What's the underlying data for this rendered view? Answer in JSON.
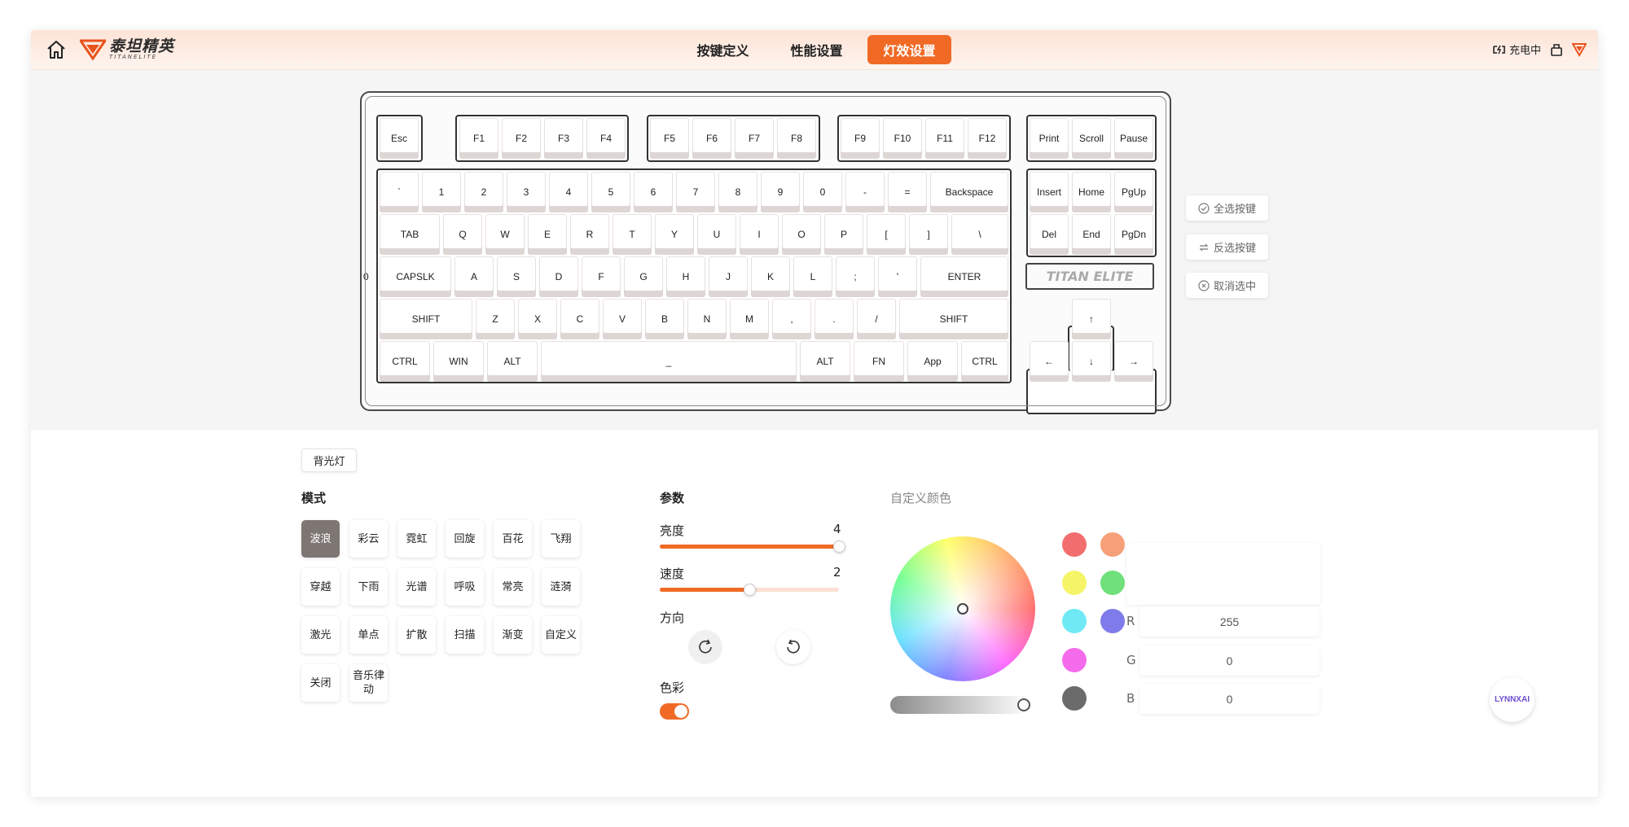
{
  "header": {
    "logo_cn": "泰坦精英",
    "logo_en": "TITANELITE",
    "tabs": [
      {
        "label": "按键定义"
      },
      {
        "label": "性能设置"
      },
      {
        "label": "灯效设置"
      }
    ],
    "active_tab": "灯效设置",
    "charging_text": "充电中"
  },
  "keyboard": {
    "rows": {
      "f_row_esc": [
        "Esc"
      ],
      "f_row_1": [
        "F1",
        "F2",
        "F3",
        "F4"
      ],
      "f_row_2": [
        "F5",
        "F6",
        "F7",
        "F8"
      ],
      "f_row_3": [
        "F9",
        "F10",
        "F11",
        "F12"
      ],
      "f_row_4": [
        "Print",
        "Scroll",
        "Pause"
      ],
      "number_row": [
        "`",
        "1",
        "2",
        "3",
        "4",
        "5",
        "6",
        "7",
        "8",
        "9",
        "0",
        "-",
        "=",
        "Backspace"
      ],
      "tab_row": [
        "TAB",
        "Q",
        "W",
        "E",
        "R",
        "T",
        "Y",
        "U",
        "I",
        "O",
        "P",
        "[",
        "]",
        "\\"
      ],
      "caps_row": [
        "CAPSLK",
        "A",
        "S",
        "D",
        "F",
        "G",
        "H",
        "J",
        "K",
        "L",
        ";",
        "'",
        "ENTER"
      ],
      "shift_row": [
        "SHIFT",
        "Z",
        "X",
        "C",
        "V",
        "B",
        "N",
        "M",
        ",",
        ".",
        "/",
        "SHIFT"
      ],
      "bottom_row": [
        "CTRL",
        "WIN",
        "ALT",
        "_",
        "ALT",
        "FN",
        "App",
        "CTRL"
      ],
      "nav_row_1": [
        "Insert",
        "Home",
        "PgUp"
      ],
      "nav_row_2": [
        "Del",
        "End",
        "PgDn"
      ],
      "arrows": [
        "↑",
        "←",
        "↓",
        "→"
      ]
    },
    "brand_plate": "TITAN ELITE",
    "edge_mark": "0"
  },
  "side_actions": [
    {
      "label": "全选按键",
      "icon": "check-circle-icon"
    },
    {
      "label": "反选按键",
      "icon": "swap-icon"
    },
    {
      "label": "取消选中",
      "icon": "x-circle-icon"
    }
  ],
  "panel": {
    "backlight_tab": "背光灯",
    "mode_title": "模式",
    "modes": [
      "波浪",
      "彩云",
      "霓虹",
      "回旋",
      "百花",
      "飞翔",
      "穿越",
      "下雨",
      "光谱",
      "呼吸",
      "常亮",
      "涟漪",
      "激光",
      "单点",
      "扩散",
      "扫描",
      "渐变",
      "自定义",
      "关闭",
      "音乐律动"
    ],
    "active_mode": "波浪",
    "params_title": "参数",
    "brightness": {
      "label": "亮度",
      "value": 4,
      "max": 4
    },
    "speed": {
      "label": "速度",
      "value": 2,
      "max": 4
    },
    "direction_label": "方向",
    "color_label": "色彩",
    "color_enabled": true
  },
  "custom_color": {
    "title": "自定义颜色",
    "swatches": [
      "#f26e6e",
      "#f6a07a",
      "#f6f56a",
      "#6fe07a",
      "#6fe9f4",
      "#7f7bea",
      "#f46cec",
      "#ffffff",
      "#6b6b6b"
    ],
    "rgb": {
      "r_label": "R",
      "r": "255",
      "g_label": "G",
      "g": "0",
      "b_label": "B",
      "b": "0"
    }
  },
  "partner_logo": "LYNNXAI"
}
